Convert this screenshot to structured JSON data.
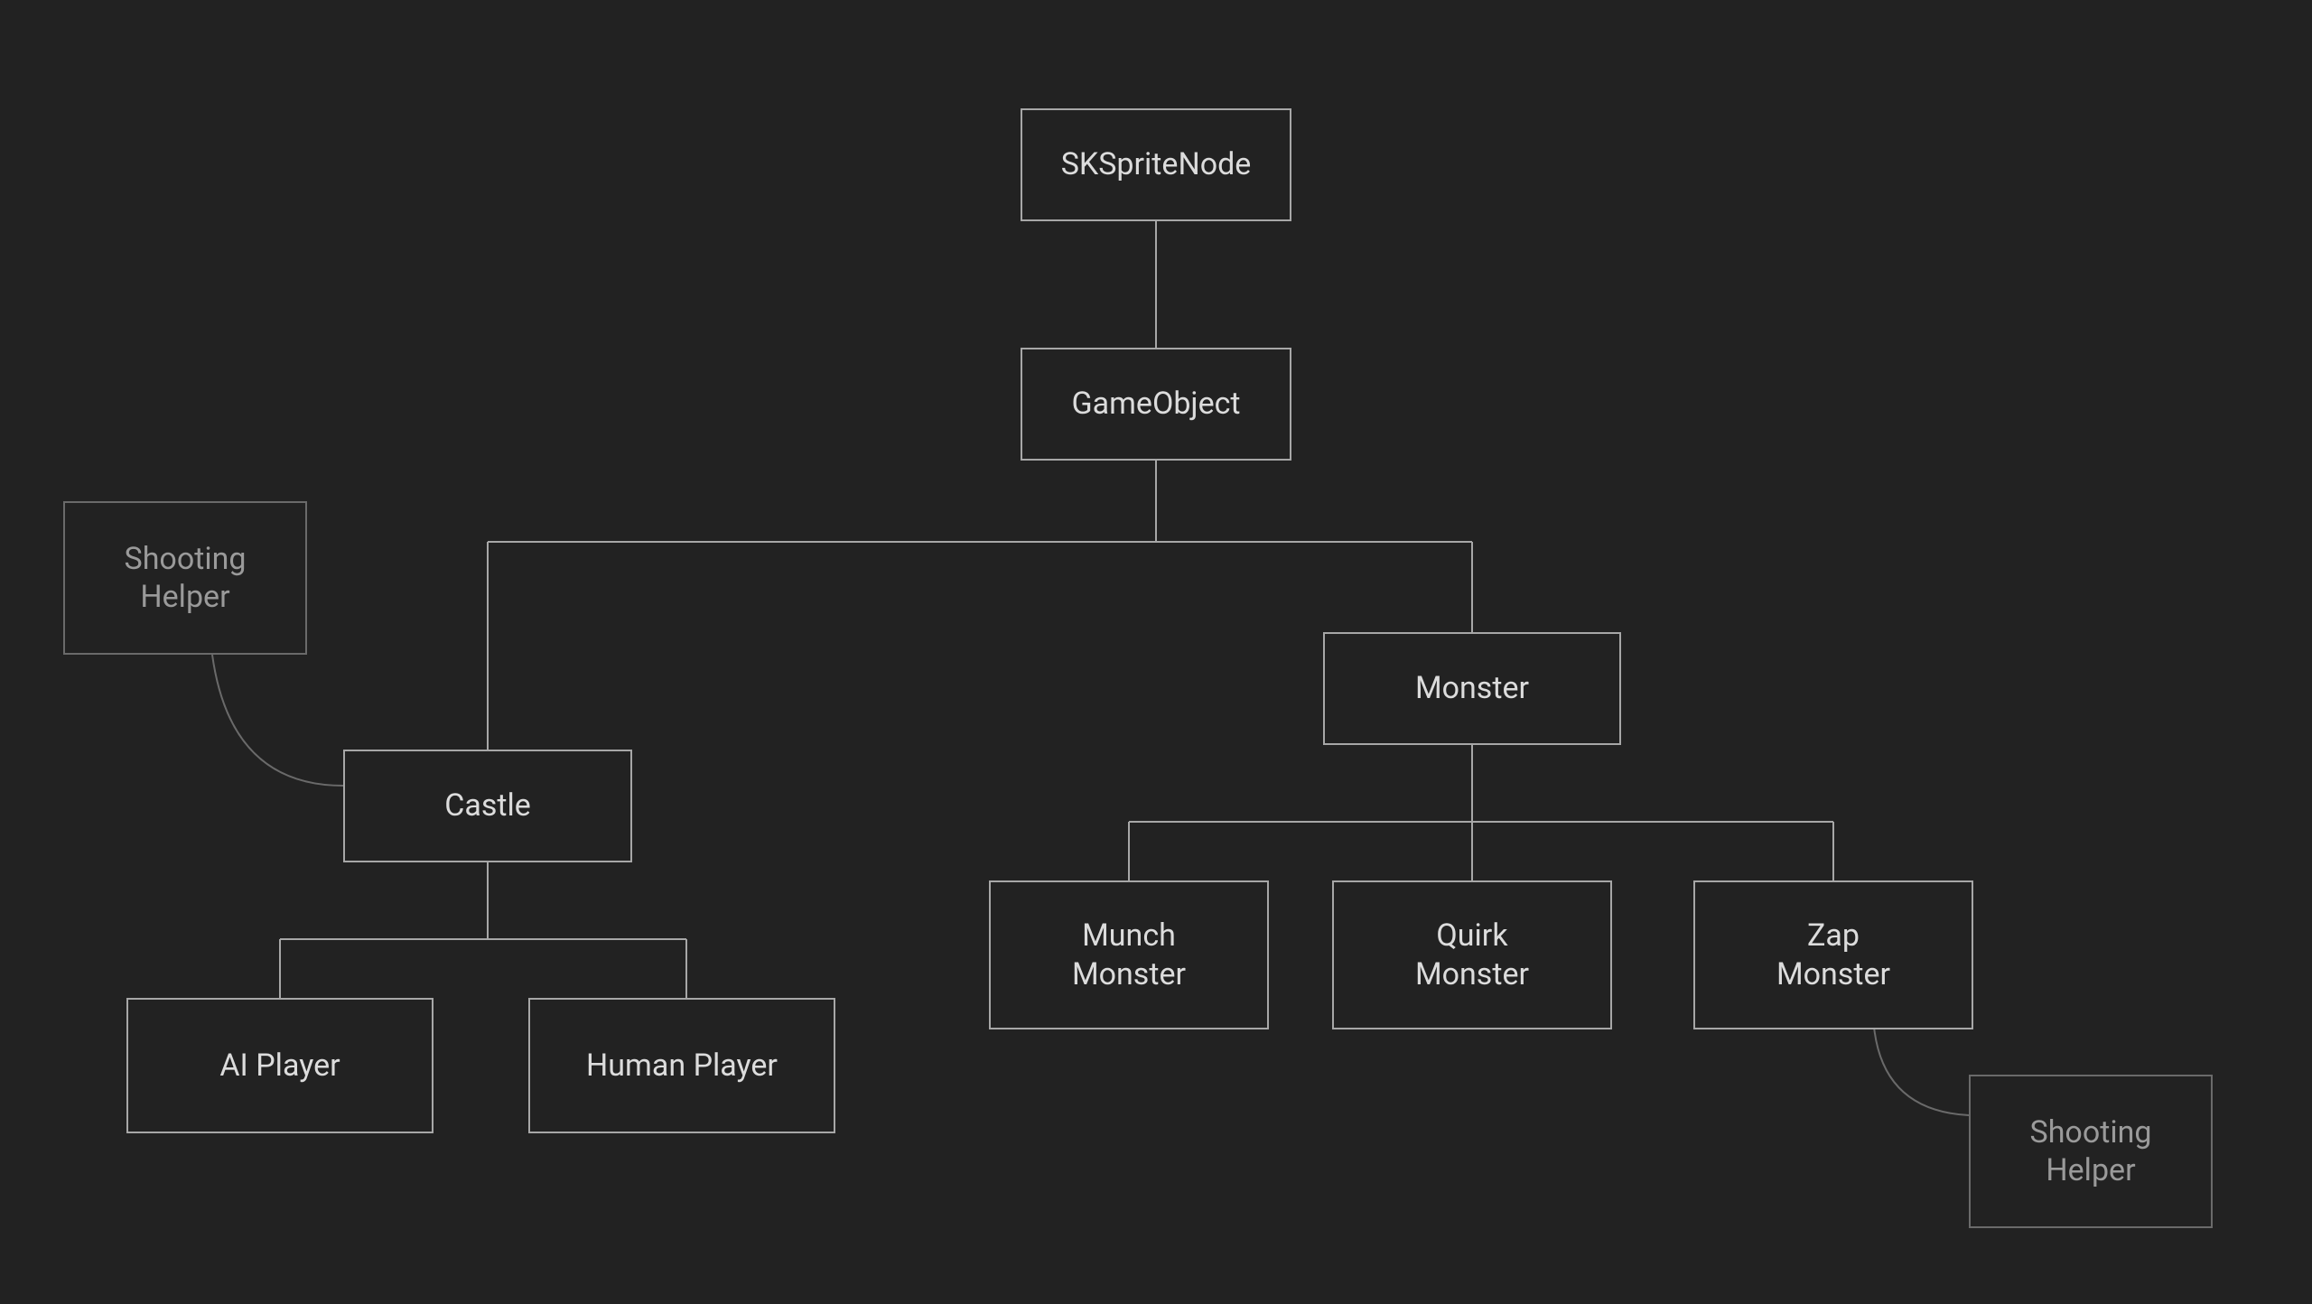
{
  "diagram": {
    "nodes": {
      "sksprite": {
        "label": "SKSpriteNode"
      },
      "gameobject": {
        "label": "GameObject"
      },
      "castle": {
        "label": "Castle"
      },
      "monster": {
        "label": "Monster"
      },
      "ai_player": {
        "label": "AI Player"
      },
      "human_player": {
        "label": "Human Player"
      },
      "munch_monster": {
        "label": "Munch\nMonster"
      },
      "quirk_monster": {
        "label": "Quirk\nMonster"
      },
      "zap_monster": {
        "label": "Zap\nMonster"
      },
      "shooting_helper_l": {
        "label": "Shooting\nHelper"
      },
      "shooting_helper_r": {
        "label": "Shooting\nHelper"
      }
    }
  }
}
